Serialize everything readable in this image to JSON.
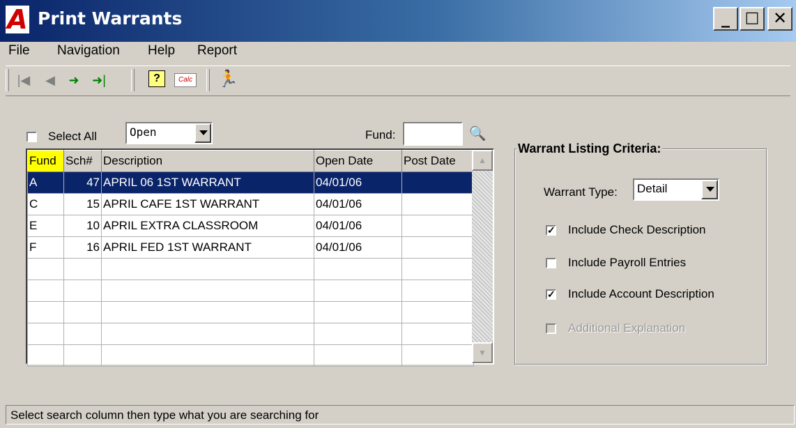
{
  "window": {
    "title": "Print Warrants",
    "logo_letter": "A",
    "minimize_glyph": "_",
    "maximize_glyph": "□",
    "close_glyph": "✕"
  },
  "menu": {
    "items": [
      "File",
      "Navigation",
      "Help",
      "Report"
    ]
  },
  "toolbar": {
    "first_glyph": "|◀",
    "prev_glyph": "◀",
    "next_glyph": "➜",
    "last_glyph": "➜|",
    "help_glyph": "?",
    "calc_label": "Calc",
    "run_glyph": "🏃"
  },
  "filter": {
    "select_all_label": "Select All",
    "status_value": "Open",
    "fund_label": "Fund:",
    "fund_value": "",
    "search_glyph": "🔍"
  },
  "grid": {
    "columns": [
      "Fund",
      "Sch#",
      "Description",
      "Open Date",
      "Post Date"
    ],
    "rows": [
      {
        "fund": "A",
        "sch": "47",
        "description": "APRIL 06 1ST WARRANT",
        "open_date": "04/01/06",
        "post_date": ""
      },
      {
        "fund": "C",
        "sch": "15",
        "description": "APRIL CAFE 1ST WARRANT",
        "open_date": "04/01/06",
        "post_date": ""
      },
      {
        "fund": "E",
        "sch": "10",
        "description": "APRIL EXTRA CLASSROOM",
        "open_date": "04/01/06",
        "post_date": ""
      },
      {
        "fund": "F",
        "sch": "16",
        "description": "APRIL FED 1ST WARRANT",
        "open_date": "04/01/06",
        "post_date": ""
      }
    ],
    "scroll_up_glyph": "▲",
    "scroll_down_glyph": "▼"
  },
  "criteria": {
    "title": "Warrant Listing Criteria:",
    "warrant_type_label": "Warrant Type:",
    "warrant_type_value": "Detail",
    "include_check_description": "Include Check Description",
    "include_payroll_entries": "Include Payroll Entries",
    "include_account_description": "Include Account Description",
    "additional_explanation": "Additional Explanation",
    "check_mark": "✓"
  },
  "statusbar": {
    "text": "Select search column then type what you are searching for"
  },
  "colors": {
    "title_start": "#0a246a",
    "title_end": "#a6caf0",
    "selection": "#0a246a",
    "active_column": "#ffff00",
    "face": "#d4d0c8"
  }
}
